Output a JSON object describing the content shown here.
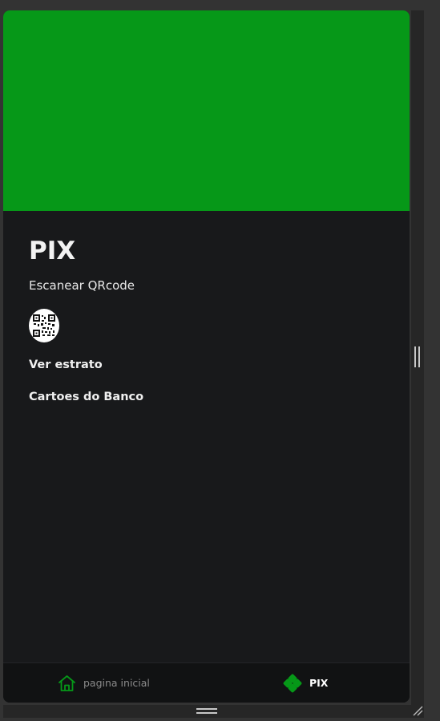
{
  "page": {
    "title": "PIX",
    "scan_label": "Escanear QRcode"
  },
  "links": {
    "statement": "Ver estrato",
    "bank_cards": "Cartoes do Banco"
  },
  "nav": {
    "home_label": "pagina inicial",
    "pix_label": "PIX",
    "active": "PIX"
  },
  "colors": {
    "hero": "#069818",
    "accent_green": "#069818",
    "background": "#18191b"
  },
  "icons": {
    "qr": "qr-code-icon",
    "home": "home-icon",
    "pix": "pix-icon"
  }
}
